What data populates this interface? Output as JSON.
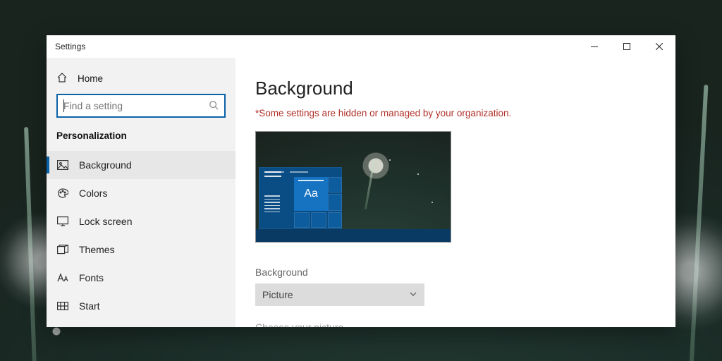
{
  "window": {
    "title": "Settings"
  },
  "sidebar": {
    "home": "Home",
    "search_placeholder": "Find a setting",
    "section": "Personalization",
    "items": [
      {
        "label": "Background",
        "active": true
      },
      {
        "label": "Colors"
      },
      {
        "label": "Lock screen"
      },
      {
        "label": "Themes"
      },
      {
        "label": "Fonts"
      },
      {
        "label": "Start"
      }
    ]
  },
  "main": {
    "heading": "Background",
    "warning": "*Some settings are hidden or managed by your organization.",
    "preview_tile_text": "Aa",
    "bg_label": "Background",
    "bg_value": "Picture",
    "choose_label": "Choose your picture"
  }
}
